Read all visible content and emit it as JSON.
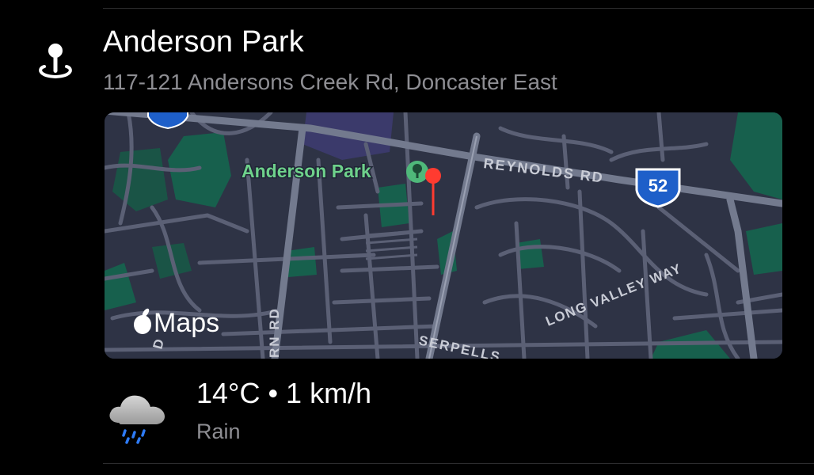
{
  "location": {
    "icon": "location-pin-icon",
    "name": "Anderson Park",
    "address": "117-121 Andersons Creek Rd, Doncaster East"
  },
  "map": {
    "brand": "Maps",
    "brand_icon": "apple-logo-icon",
    "poi_label": "Anderson Park",
    "poi_icon": "park-tree-icon",
    "pin_icon": "red-map-pin-icon",
    "streets": {
      "reynolds": "REYNOLDS RD",
      "long_valley": "LONG VALLEY WAY",
      "serpells": "SERPELLS",
      "rn_rd": "RN RD",
      "left_d": "D"
    },
    "route_shield": "52",
    "colors": {
      "background": "#2e3345",
      "streets": "#5b6075",
      "main_road": "#737a8e",
      "park": "#17604d",
      "poi_text": "#6ed18b",
      "pin": "#ff3b30",
      "shield": "#1e5fc9"
    }
  },
  "weather": {
    "icon": "rain-cloud-icon",
    "summary": "14°C • 1 km/h",
    "condition": "Rain"
  }
}
